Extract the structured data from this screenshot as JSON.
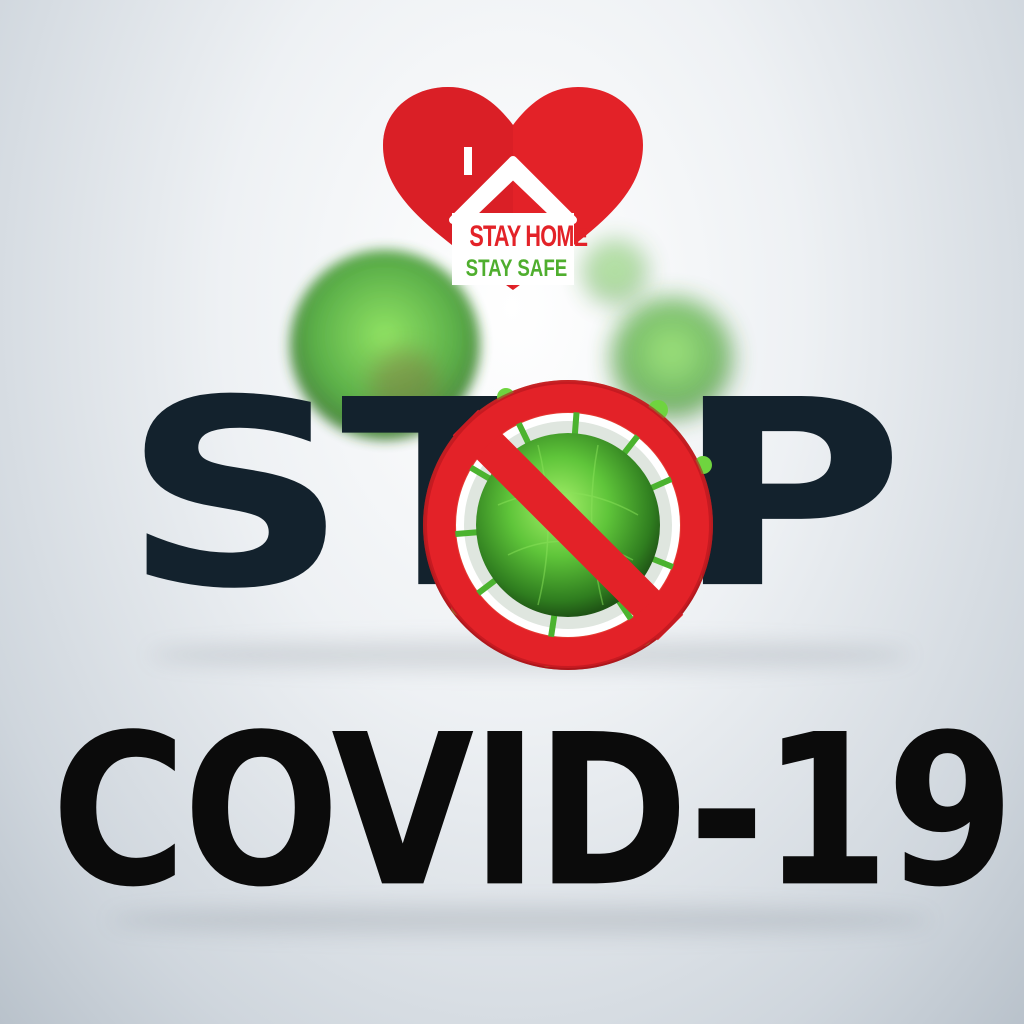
{
  "logo": {
    "line1": "STAY HOME",
    "line2": "STAY SAFE",
    "heart_color": "#e32228",
    "line1_color": "#e32228",
    "line2_color": "#4fae2e",
    "house_color": "#ffffff"
  },
  "headline": {
    "stop_prefix": "ST",
    "stop_suffix": "P",
    "stop_color": "#13222d",
    "covid": "COVID-19",
    "covid_color": "#0b0b0b"
  },
  "icons": {
    "logo": "heart-house-icon",
    "no_sign": "prohibition-sign-icon",
    "virus": "virus-icon"
  },
  "colors": {
    "virus_green": "#5fc53a",
    "sign_red": "#e32228"
  }
}
